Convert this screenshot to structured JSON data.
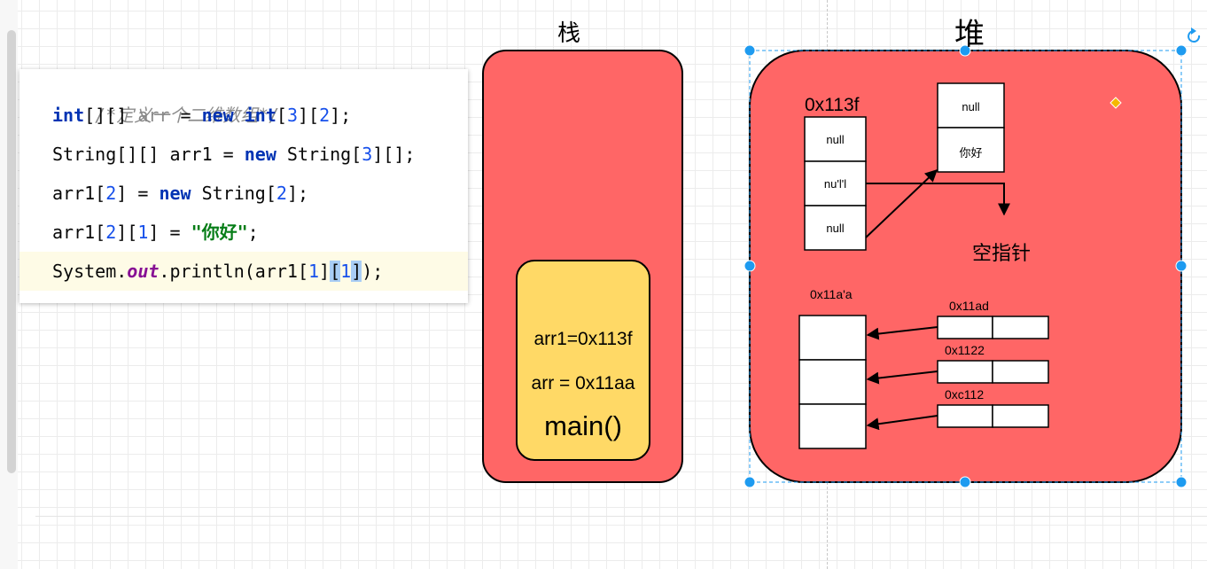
{
  "editor": {
    "comment": "/*定义一个二维数组*/",
    "line1": {
      "kw1": "int",
      "t1": "[][] ",
      "var": "arr",
      "t2": " = ",
      "kw2": "new",
      "t3": " ",
      "kw3": "int",
      "t4": "[",
      "n1": "3",
      "t5": "][",
      "n2": "2",
      "t6": "];"
    },
    "line2": {
      "t1": "String[][] arr1 = ",
      "kw1": "new",
      "t2": " String[",
      "n1": "3",
      "t3": "][];"
    },
    "line3": {
      "t1": "arr1[",
      "n1": "2",
      "t2": "] = ",
      "kw1": "new",
      "t3": " String[",
      "n2": "2",
      "t4": "];"
    },
    "line4": {
      "t1": "arr1[",
      "n1": "2",
      "t2": "][",
      "n2": "1",
      "t3": "] = ",
      "s1": "\"你好\"",
      "t4": ";"
    },
    "line5": {
      "t1": "System.",
      "f1": "out",
      "t2": ".println(arr1[",
      "n1": "1",
      "t3": "]",
      "b1": "[",
      "n2": "1",
      "b2": "]",
      "t4": ");"
    }
  },
  "stack": {
    "title": "栈",
    "frame": {
      "line1": "arr1=0x113f",
      "line2": "arr = 0x11aa",
      "name": "main()"
    }
  },
  "heap": {
    "title": "堆",
    "array_a": {
      "address": "0x113f",
      "cells": [
        "null",
        "nu'l'l",
        "null"
      ]
    },
    "array_b": {
      "cells": [
        "null",
        "你好"
      ]
    },
    "null_pointer_label": "空指针",
    "array_c": {
      "address": "0x11a'a"
    },
    "subarrays": [
      {
        "address": "0x11ad"
      },
      {
        "address": "0x1122"
      },
      {
        "address": "0xc112"
      }
    ]
  },
  "colors": {
    "region_fill": "#ff6666",
    "frame_fill": "#ffd966",
    "selection": "#1e9bf0",
    "handle": "#f5b800"
  }
}
